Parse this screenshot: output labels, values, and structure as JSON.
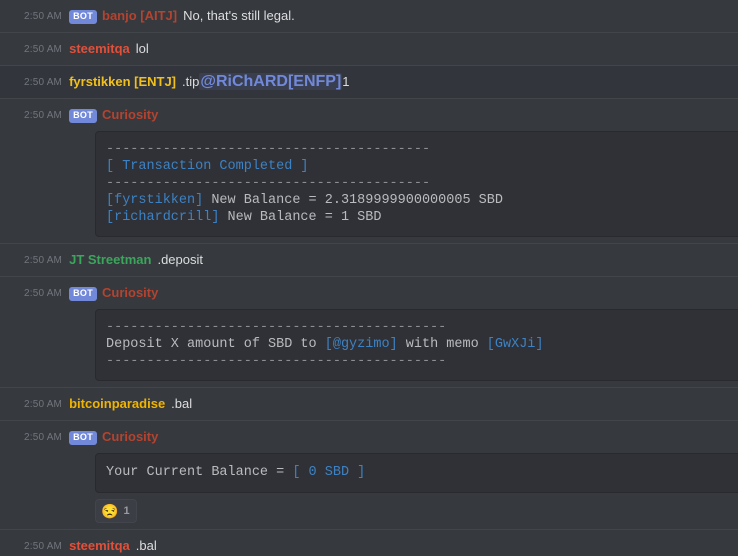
{
  "app": {
    "platform": "discord-chat-log",
    "colors": {
      "background": "#36393e",
      "background_alt": "#32353b",
      "codeblock_bg": "#2f3136",
      "separator": "#42454a",
      "bot_badge": "#7289da",
      "text": "#dcddde",
      "timestamp": "#72767d",
      "code_highlight": "#3d82c4",
      "name_red": "#e0503a",
      "name_yellow": "#f2c01c",
      "name_green": "#3ca55c"
    }
  },
  "labels": {
    "bot_badge": "BOT"
  },
  "messages": [
    {
      "timestamp": "2:50 AM",
      "is_bot": true,
      "username": "banjo [AITJ]",
      "name_color": "red-dim",
      "content": "No, that's still legal."
    },
    {
      "timestamp": "2:50 AM",
      "is_bot": false,
      "username": "steemitqa",
      "name_color": "red",
      "content": "lol"
    },
    {
      "timestamp": "2:50 AM",
      "is_bot": false,
      "username": "fyrstikken [ENTJ]",
      "name_color": "yellow",
      "content_pre": ".tip ",
      "mention": "@RiChARD[ENFP]",
      "content_post": " 1"
    },
    {
      "timestamp": "2:50 AM",
      "is_bot": true,
      "username": "Curiosity",
      "name_color": "red-dim",
      "code": {
        "rule_top": "----------------------------------------",
        "title": "[ Transaction Completed ]",
        "rule_mid": "----------------------------------------",
        "line1_tag": "[fyrstikken]",
        "line1_text": " New Balance = 2.3189999900000005 SBD",
        "line2_tag": "[richardcrill]",
        "line2_text": " New Balance = 1 SBD"
      }
    },
    {
      "timestamp": "2:50 AM",
      "is_bot": false,
      "username": "JT Streetman",
      "name_color": "green",
      "content": ".deposit"
    },
    {
      "timestamp": "2:50 AM",
      "is_bot": true,
      "username": "Curiosity",
      "name_color": "red-dim",
      "code": {
        "rule_top": "------------------------------------------",
        "text_pre": "Deposit X amount of SBD to ",
        "account": "[@gyzimo]",
        "text_mid": " with memo ",
        "memo": "[GwXJi]",
        "rule_bottom": "------------------------------------------"
      }
    },
    {
      "timestamp": "2:50 AM",
      "is_bot": false,
      "username": "bitcoinparadise",
      "name_color": "gold",
      "content": ".bal"
    },
    {
      "timestamp": "2:50 AM",
      "is_bot": true,
      "username": "Curiosity",
      "name_color": "red-dim",
      "code": {
        "text_pre": "Your Current Balance = ",
        "balance": "[ 0 SBD ]"
      },
      "reaction": {
        "emoji": "unamused-face",
        "glyph": "😒",
        "count": "1"
      }
    },
    {
      "timestamp": "2:50 AM",
      "is_bot": false,
      "username": "steemitqa",
      "name_color": "red",
      "content": ".bal"
    }
  ]
}
